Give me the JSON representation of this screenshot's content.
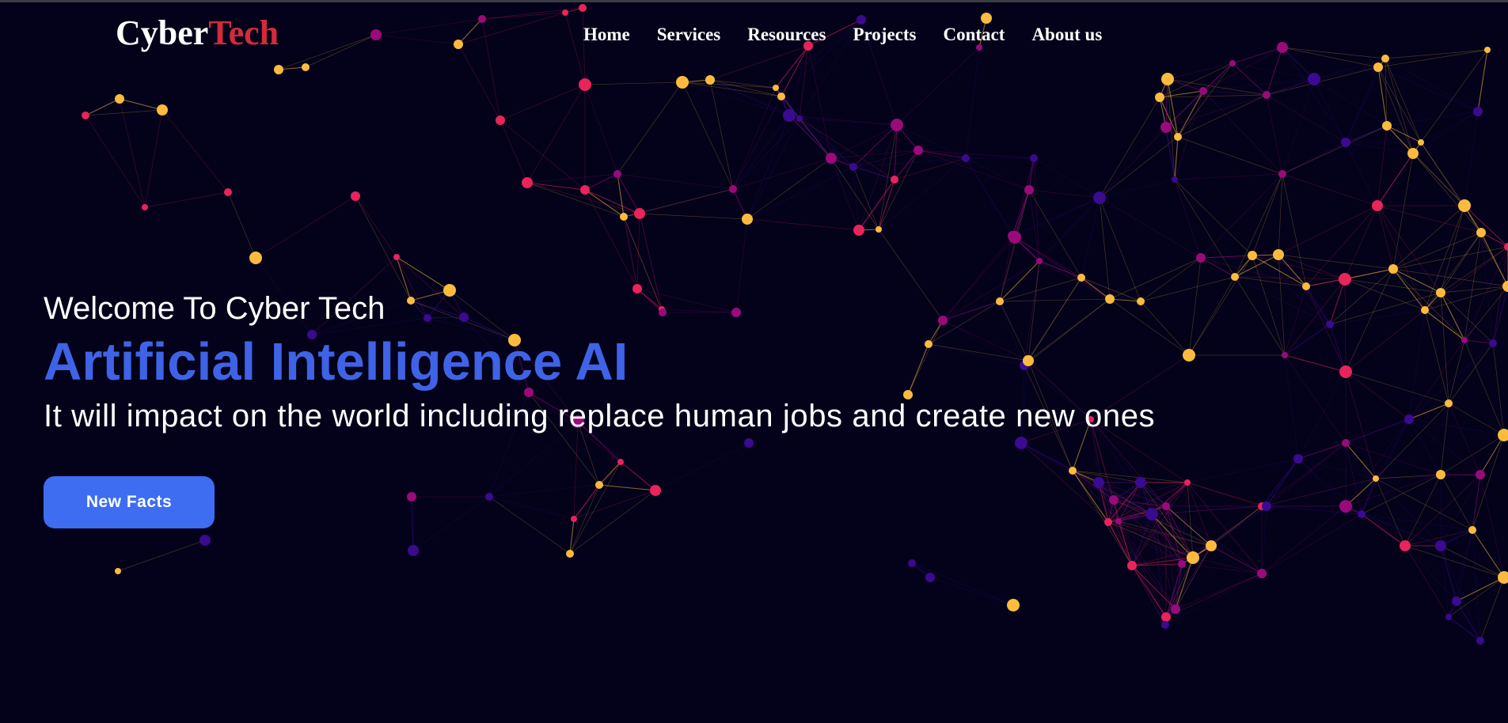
{
  "logo": {
    "part1": "Cyber",
    "part2": "Tech"
  },
  "nav": {
    "items": [
      "Home",
      "Services",
      "Resources",
      "Projects",
      "Contact",
      "About us"
    ]
  },
  "hero": {
    "welcome": "Welcome To Cyber Tech",
    "headline": "Artificial Intelligence AI",
    "tagline": "It will impact on the world including replace human jobs and create new ones",
    "button_label": "New Facts"
  },
  "colors": {
    "background": "#03021a",
    "accent_blue": "#3f63e6",
    "button_blue": "#3e6df2",
    "logo_red": "#d42a3c",
    "particle_yellow": "#fdbb3e",
    "particle_red": "#e8245a",
    "particle_magenta": "#9a0a7a",
    "particle_purple": "#3a0a90"
  }
}
